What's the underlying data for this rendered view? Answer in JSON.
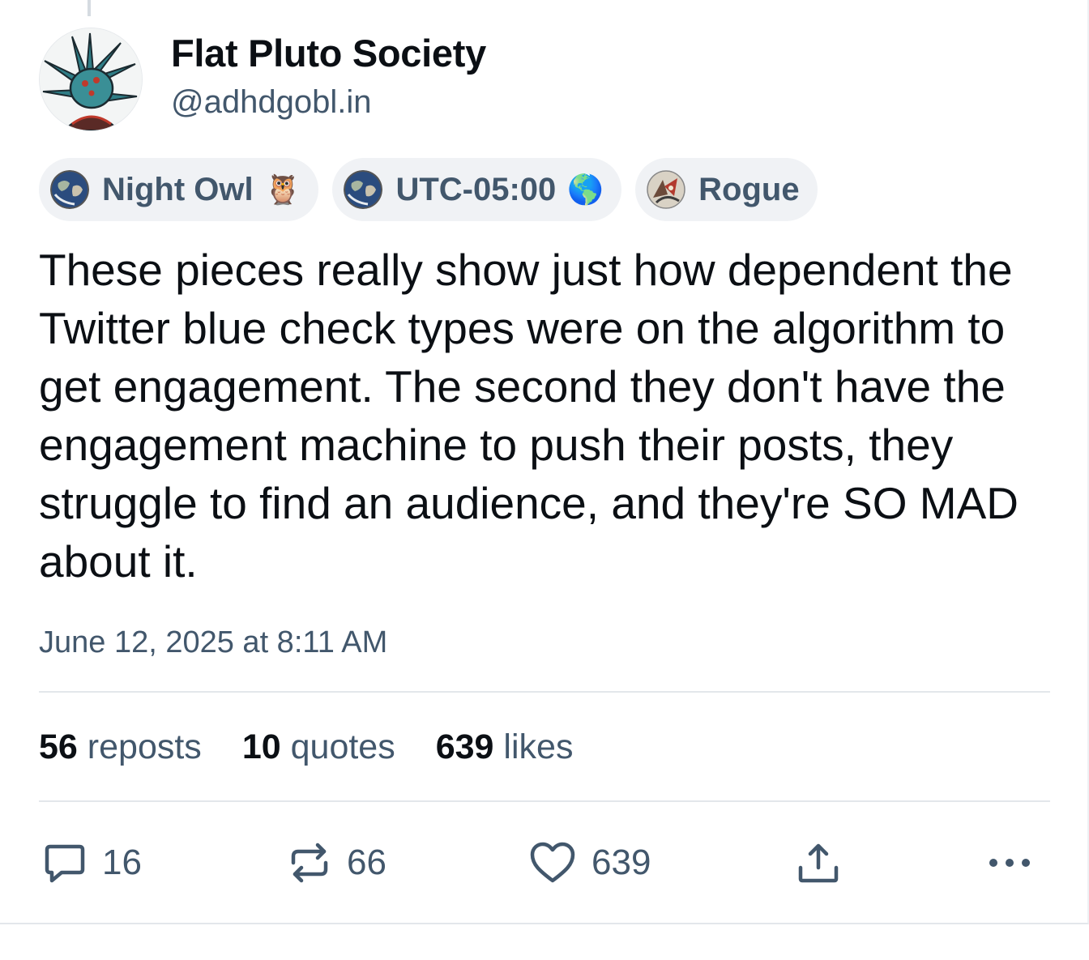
{
  "author": {
    "display_name": "Flat Pluto Society",
    "handle": "@adhdgobl.in"
  },
  "badges": [
    {
      "label": "Night Owl",
      "emoji": "🦉",
      "icon": "earth-globe-icon"
    },
    {
      "label": "UTC-05:00",
      "emoji": "🌎",
      "icon": "earth-globe-icon"
    },
    {
      "label": "Rogue",
      "emoji": "",
      "icon": "rogue-art-icon"
    }
  ],
  "post": {
    "text": "These pieces really show just how dependent the Twitter blue check types were on the algorithm to get engagement. The second they don't have the engagement machine to push their posts, they struggle to find an audience, and they're SO MAD about it.",
    "timestamp": "June 12, 2025 at 8:11 AM"
  },
  "stats": {
    "reposts": {
      "count": "56",
      "label": "reposts"
    },
    "quotes": {
      "count": "10",
      "label": "quotes"
    },
    "likes": {
      "count": "639",
      "label": "likes"
    }
  },
  "actions": {
    "reply": {
      "icon": "reply-icon",
      "count": "16"
    },
    "repost": {
      "icon": "repost-icon",
      "count": "66"
    },
    "like": {
      "icon": "heart-icon",
      "count": "639"
    },
    "share": {
      "icon": "share-icon"
    },
    "more": {
      "icon": "more-icon"
    }
  },
  "colors": {
    "text_primary": "#0b0f14",
    "text_secondary": "#42576c",
    "badge_bg": "#f0f2f5",
    "divider": "#e3e7eb"
  }
}
